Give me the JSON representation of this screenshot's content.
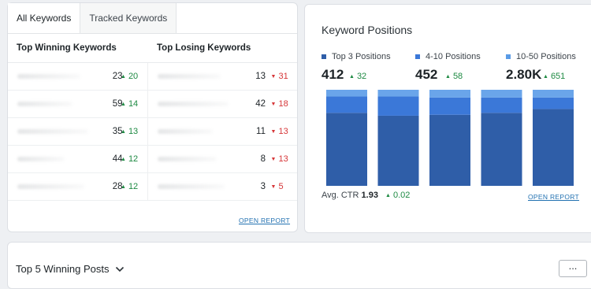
{
  "tabs": [
    "All Keywords",
    "Tracked Keywords"
  ],
  "keywords": {
    "winning_header": "Top Winning Keywords",
    "losing_header": "Top Losing Keywords",
    "rows": [
      {
        "win_rank": "23",
        "win_change": "20",
        "lose_rank": "13",
        "lose_change": "31"
      },
      {
        "win_rank": "59",
        "win_change": "14",
        "lose_rank": "42",
        "lose_change": "18"
      },
      {
        "win_rank": "35",
        "win_change": "13",
        "lose_rank": "11",
        "lose_change": "13"
      },
      {
        "win_rank": "44",
        "win_change": "12",
        "lose_rank": "8",
        "lose_change": "13"
      },
      {
        "win_rank": "28",
        "win_change": "12",
        "lose_rank": "3",
        "lose_change": "5"
      }
    ],
    "open_report": "OPEN REPORT"
  },
  "positions": {
    "title": "Keyword Positions",
    "groups": [
      {
        "label": "Top 3 Positions",
        "color": "#2f5ea8",
        "value": "412",
        "change": "32"
      },
      {
        "label": "4-10 Positions",
        "color": "#3b78d8",
        "value": "452",
        "change": "58"
      },
      {
        "label": "10-50 Positions",
        "color": "#5a9be6",
        "value": "2.80K",
        "change": "651"
      }
    ],
    "ctr_label": "Avg. CTR",
    "ctr_value": "1.93",
    "ctr_change": "0.02",
    "open_report": "OPEN REPORT"
  },
  "chart_data": {
    "type": "bar",
    "stacked": true,
    "categories": [
      "",
      "",
      "",
      "",
      ""
    ],
    "series": [
      {
        "name": "Top 3 Positions",
        "color": "#2f5ea8",
        "values": [
          0.76,
          0.73,
          0.74,
          0.76,
          0.8
        ]
      },
      {
        "name": "4-10 Positions",
        "color": "#3b78d8",
        "values": [
          0.17,
          0.2,
          0.18,
          0.16,
          0.12
        ]
      },
      {
        "name": "10-50 Positions",
        "color": "#6aa5ea",
        "values": [
          0.07,
          0.07,
          0.08,
          0.08,
          0.08
        ]
      }
    ],
    "ylim": [
      0,
      1
    ],
    "legend": "top"
  },
  "posts": {
    "title": "Top 5 Winning Posts",
    "more_label": "..."
  }
}
